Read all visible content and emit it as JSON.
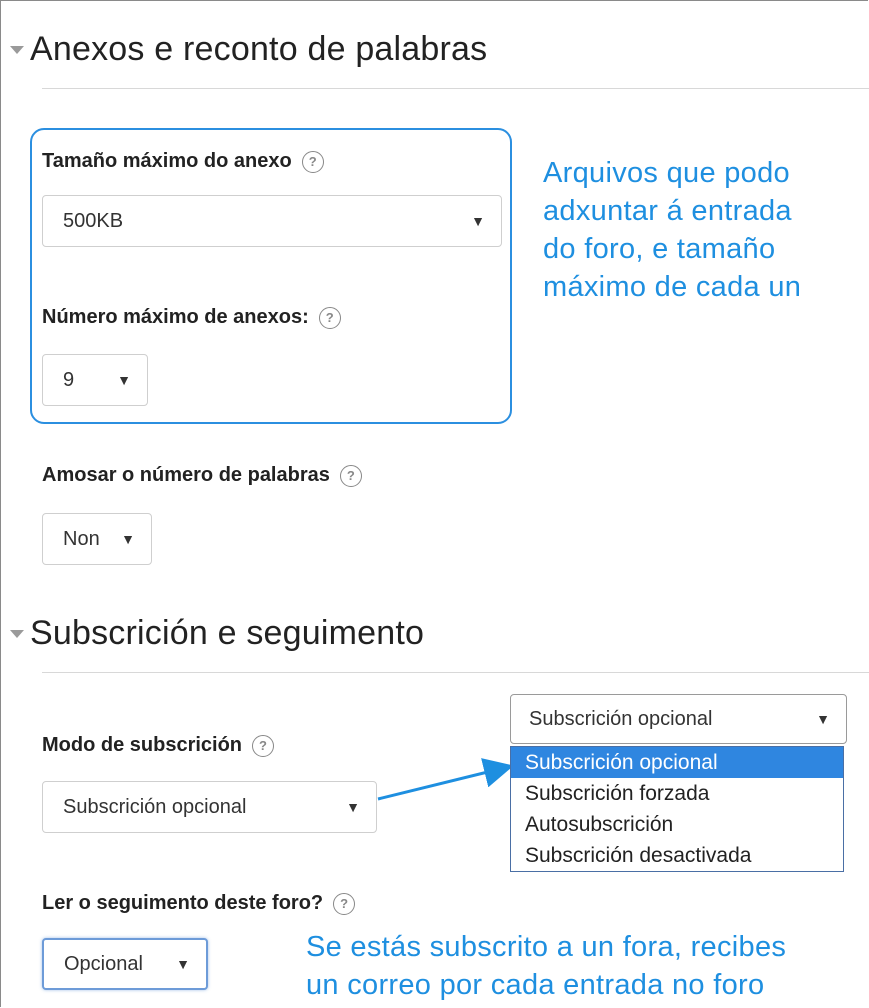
{
  "section1": {
    "title": "Anexos e reconto de palabras"
  },
  "max_attachment_size": {
    "label": "Tamaño máximo do anexo",
    "value": "500KB"
  },
  "max_attachments": {
    "label": "Número máximo de anexos:",
    "value": "9"
  },
  "note1": {
    "lines": [
      "Arquivos que podo",
      "adxuntar á entrada",
      "do foro, e tamaño",
      "máximo de cada un"
    ]
  },
  "word_count": {
    "label": "Amosar o número de palabras",
    "value": "Non"
  },
  "section2": {
    "title": "Subscrición e seguimento"
  },
  "subscription_mode": {
    "label": "Modo de subscrición",
    "value": "Subscrición opcional",
    "open_select_value": "Subscrición opcional",
    "options": [
      "Subscrición opcional",
      "Subscrición forzada",
      "Autosubscrición",
      "Subscrición desactivada"
    ]
  },
  "tracking": {
    "label": "Ler o seguimento deste foro?",
    "value": "Opcional"
  },
  "note2": {
    "lines": [
      "Se estás subscrito a un fora, recibes",
      "un correo por cada entrada no foro"
    ]
  },
  "colors": {
    "accent": "#2b8fe0",
    "selected_option": "#2f86e0"
  },
  "icons": {
    "help": "?",
    "arrow": "▼",
    "collapse": "triangle-down"
  }
}
